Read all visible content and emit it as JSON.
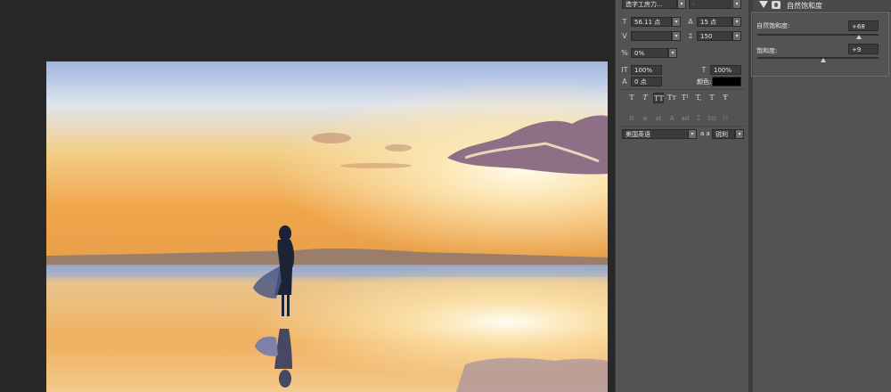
{
  "character_panel": {
    "font_family": "造字工房力...",
    "font_style": "-",
    "font_size": "56.11 点",
    "leading": "15 点",
    "kerning": "",
    "tracking": "150",
    "tsume": "0%",
    "vertical_scale": "100%",
    "horizontal_scale": "100%",
    "baseline_shift": "0 点",
    "color_label": "颜色:",
    "style_buttons": [
      "T",
      "T",
      "TT",
      "Tт",
      "T¹",
      "T,",
      "T",
      "Ŧ"
    ],
    "opentype_buttons": [
      "fi",
      "ø",
      "st",
      "A",
      "ad",
      "T",
      "1st",
      "½"
    ],
    "language": "美国英语",
    "aa_label": "a a",
    "antialias": "锐利"
  },
  "properties_panel": {
    "title": "自然饱和度",
    "vibrance_label": "自然饱和度:",
    "vibrance_value": "+68",
    "vibrance_level": 0.84,
    "saturation_label": "饱和度:",
    "saturation_value": "+9",
    "saturation_level": 0.545
  },
  "colors": {
    "panel_bg": "#535353",
    "workspace_bg": "#282828",
    "highlight_box": "#d04040",
    "text_color_swatch": "#000000"
  }
}
